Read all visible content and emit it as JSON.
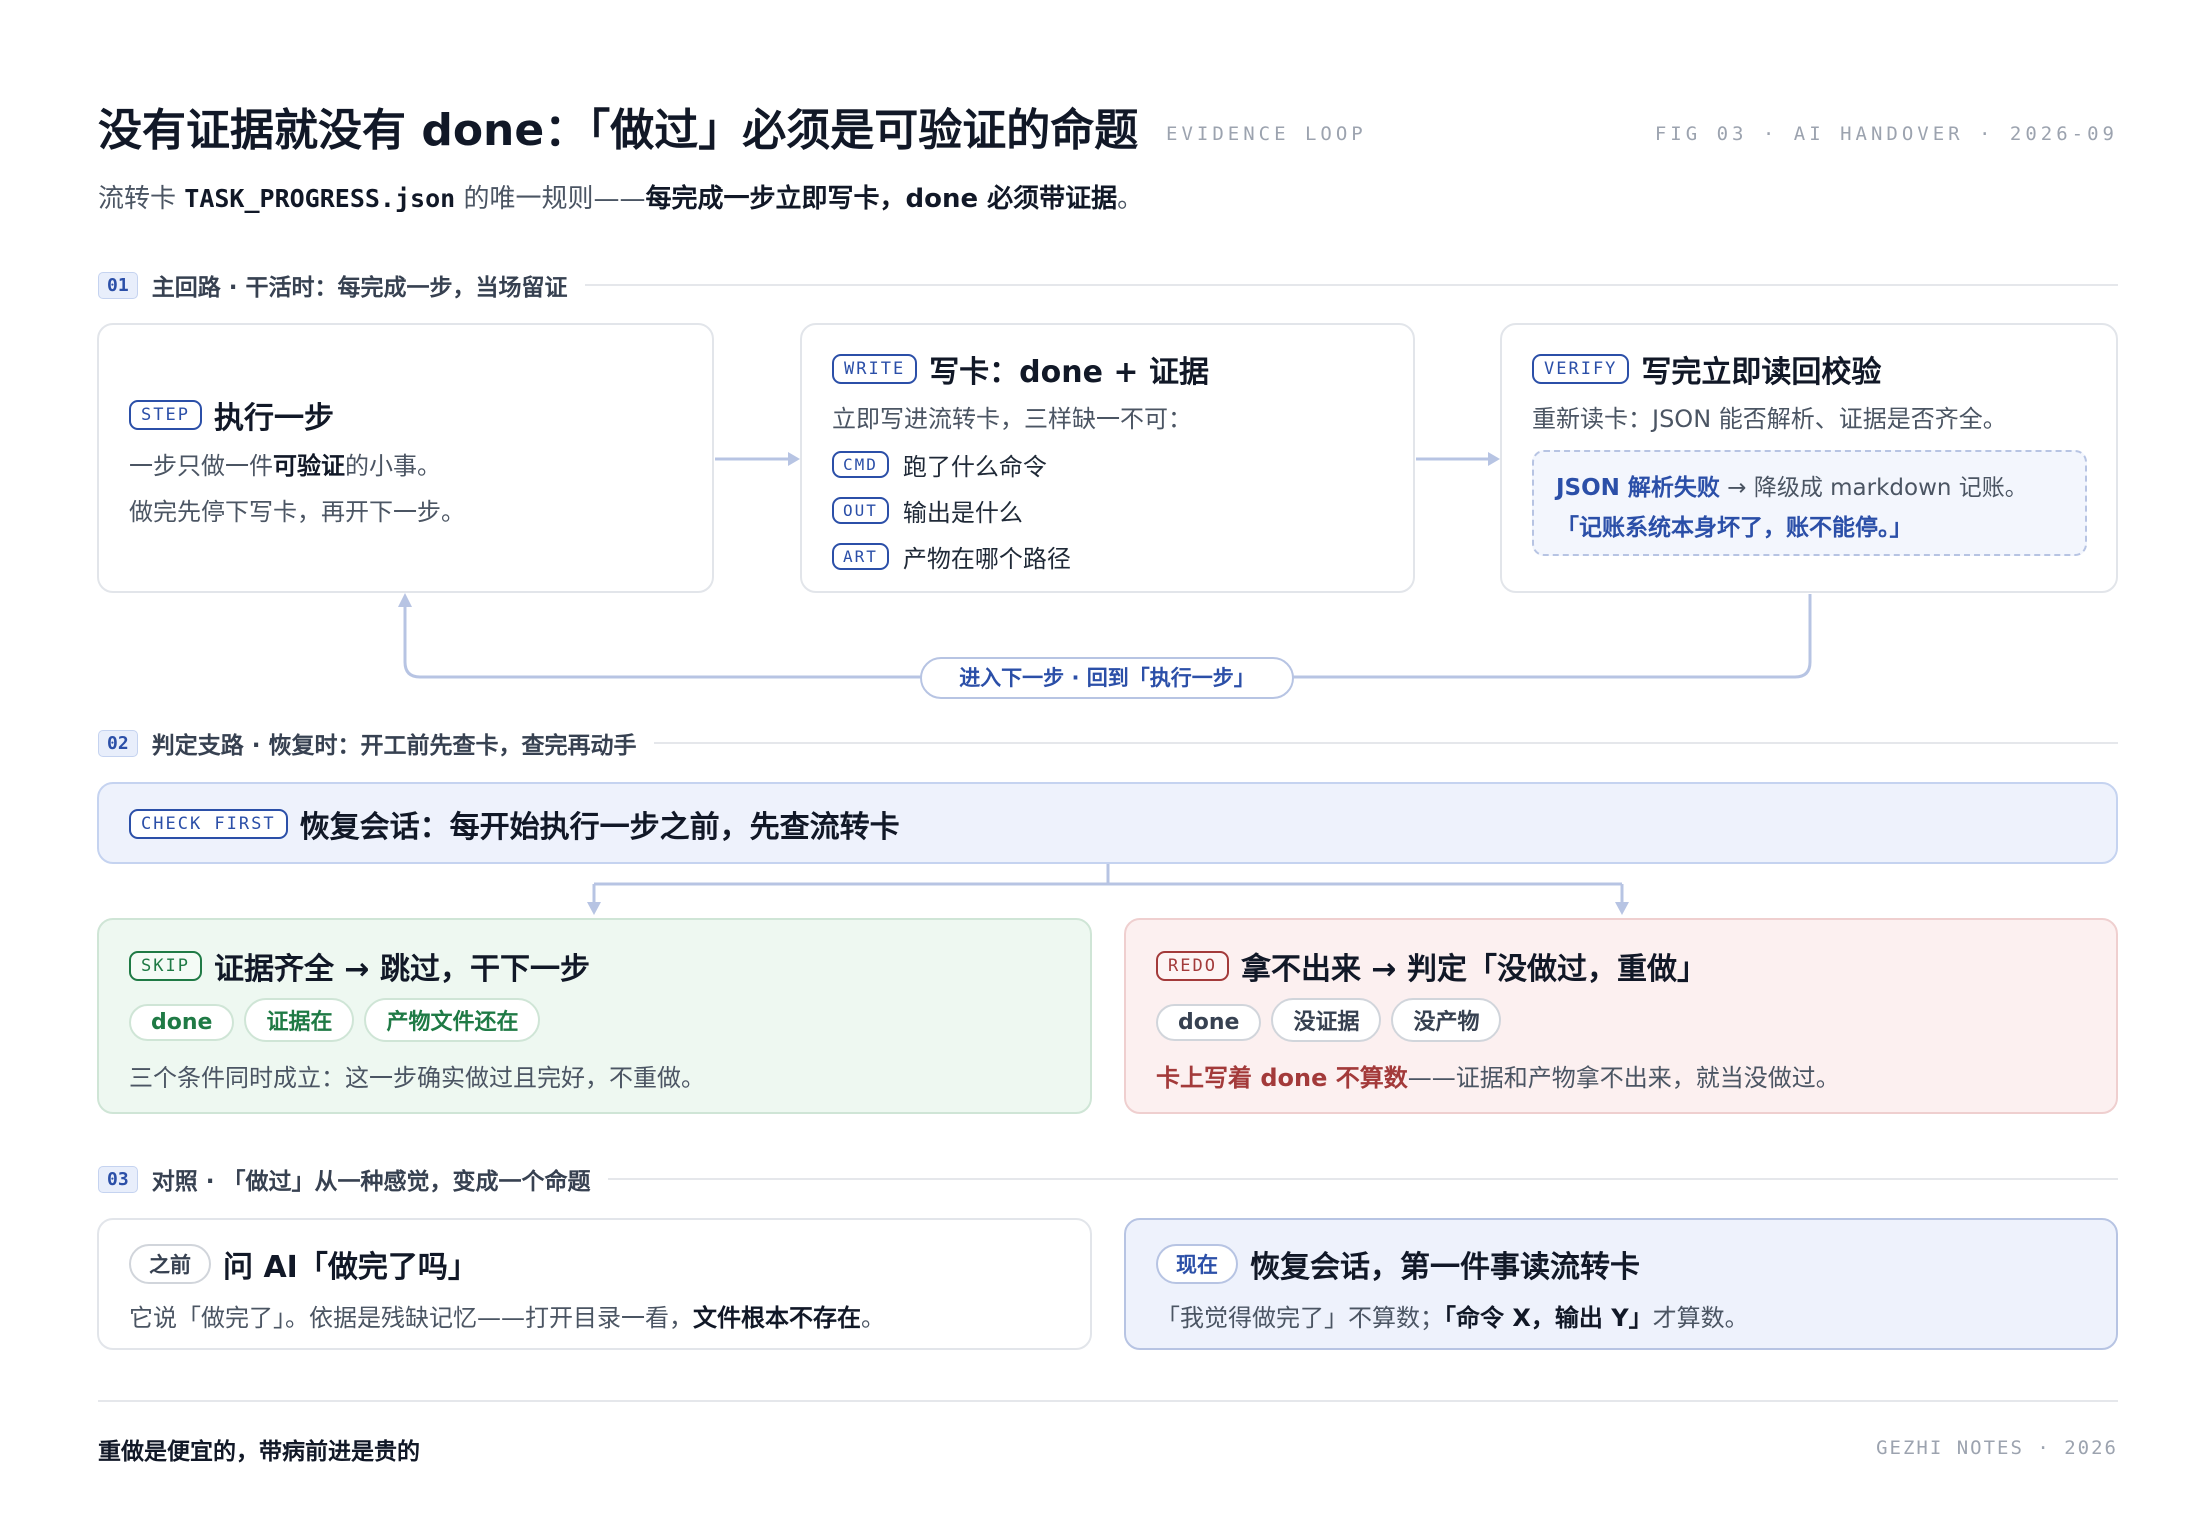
{
  "header": {
    "title": "没有证据就没有 done：「做过」必须是可验证的命题",
    "tag": "EVIDENCE LOOP",
    "fig": "FIG 03 · AI HANDOVER · 2026-09",
    "subtitle_pre": "流转卡 ",
    "subtitle_code": "TASK_PROGRESS.json",
    "subtitle_mid": " 的唯一规则——",
    "subtitle_bold": "每完成一步立即写卡，done 必须带证据",
    "subtitle_end": "。"
  },
  "sections": [
    {
      "num": "01",
      "label": "主回路 · 干活时：每完成一步，当场留证"
    },
    {
      "num": "02",
      "label": "判定支路 · 恢复时：开工前先查卡，查完再动手"
    },
    {
      "num": "03",
      "label": "对照 · 「做过」从一种感觉，变成一个命题"
    }
  ],
  "step": {
    "badge": "STEP",
    "title": "执行一步",
    "line1_pre": "一步只做一件",
    "line1_bold": "可验证",
    "line1_post": "的小事。",
    "line2": "做完先停下写卡，再开下一步。"
  },
  "write": {
    "badge": "WRITE",
    "title": "写卡：done + 证据",
    "desc": "立即写进流转卡，三样缺一不可：",
    "items": [
      {
        "tag": "CMD",
        "text": "跑了什么命令"
      },
      {
        "tag": "OUT",
        "text": "输出是什么"
      },
      {
        "tag": "ART",
        "text": "产物在哪个路径"
      }
    ]
  },
  "verify": {
    "badge": "VERIFY",
    "title": "写完立即读回校验",
    "desc": "重新读卡：JSON 能否解析、证据是否齐全。",
    "fail_bold": "JSON 解析失败",
    "fail_rest": " → 降级成 markdown 记账。",
    "fail_quote": "「记账系统本身坏了，账不能停。」"
  },
  "loop_label": "进入下一步 · 回到「执行一步」",
  "check": {
    "badge": "CHECK FIRST",
    "title": "恢复会话：每开始执行一步之前，先查流转卡"
  },
  "skip": {
    "badge": "SKIP",
    "title": "证据齐全 → 跳过，干下一步",
    "pills": [
      "done",
      "证据在",
      "产物文件还在"
    ],
    "desc": "三个条件同时成立：这一步确实做过且完好，不重做。"
  },
  "redo": {
    "badge": "REDO",
    "title": "拿不出来 → 判定「没做过，重做」",
    "pills": [
      "done",
      "没证据",
      "没产物"
    ],
    "desc_bold": "卡上写着 done 不算数",
    "desc_rest": "——证据和产物拿不出来，就当没做过。"
  },
  "before": {
    "tag": "之前",
    "title": "问 AI「做完了吗」",
    "desc_pre": "它说「做完了」。依据是残缺记忆——打开目录一看，",
    "desc_bold": "文件根本不存在",
    "desc_end": "。"
  },
  "now": {
    "tag": "现在",
    "title": "恢复会话，第一件事读流转卡",
    "desc_pre": "「我觉得做完了」不算数；",
    "desc_bold": "「命令 X，输出 Y」",
    "desc_end": "才算数。"
  },
  "footer": {
    "left": "重做是便宜的，带病前进是贵的",
    "right": "GEZHI NOTES · 2026"
  },
  "colors": {
    "accent": "#2b4fa8",
    "green": "#1f7a45",
    "red": "#a33a3a",
    "connector": "#b7c4e3"
  }
}
